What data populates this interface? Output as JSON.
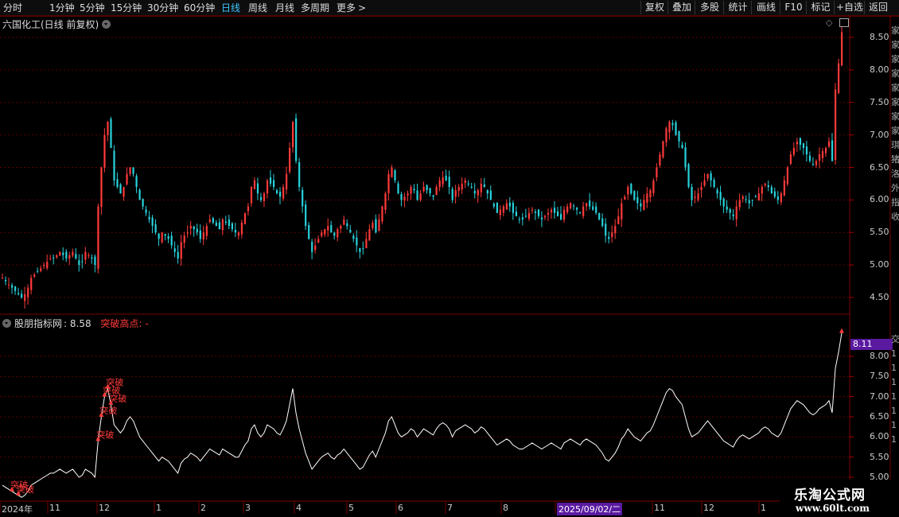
{
  "toolbar": {
    "periods": [
      "分时",
      "1分钟",
      "5分钟",
      "15分钟",
      "30分钟",
      "60分钟",
      "日线",
      "周线",
      "月线",
      "多周期",
      "更多"
    ],
    "active_period": "日线",
    "buttons": [
      "复权",
      "叠加",
      "多股",
      "统计",
      "画线",
      "F10",
      "标记",
      "+自选",
      "返回"
    ],
    "more_arrow": ">"
  },
  "main_pane": {
    "title": "六国化工(日线 前复权)",
    "y_ticks": [
      "8.50",
      "8.00",
      "7.50",
      "7.00",
      "6.50",
      "6.00",
      "5.50",
      "5.00",
      "4.50"
    ]
  },
  "indicator_pane": {
    "name": "股朋指标网",
    "value": ": 8.58",
    "signal_label": "突破高点:",
    "signal_value": "-",
    "y_ticks": [
      "8.00",
      "7.50",
      "7.00",
      "6.50",
      "6.00",
      "5.50",
      "5.00"
    ],
    "current_badge": "8.11",
    "marker_text": "突破"
  },
  "x_axis": {
    "labels": [
      "2024年",
      "11",
      "12",
      "1",
      "2",
      "3",
      "4",
      "5",
      "6",
      "7",
      "8",
      "2025/09/02/二",
      "11",
      "12",
      "1"
    ]
  },
  "right_strip": {
    "top": [
      "家",
      "家",
      "家",
      "家",
      "家",
      "家",
      "家",
      "家",
      "琪",
      "猪",
      "洛",
      "外",
      "指",
      "收"
    ],
    "bottom": [
      "交",
      "1",
      "1",
      "1",
      "1",
      "1",
      "1",
      "1"
    ]
  },
  "watermark": {
    "line1": "乐淘公式网",
    "line2": "www.60lt.com"
  },
  "colors": {
    "up": "#ff3a3a",
    "down": "#28d2dc",
    "grid": "#5a0000",
    "line": "#ffffff",
    "active": "#3fc6ff",
    "badge_bg": "#5a1aa0",
    "date_bg": "#5a1aa0"
  },
  "chart_data": {
    "type": "candlestick",
    "title": "六国化工(日线 前复权)",
    "ylim": [
      4.3,
      8.7
    ],
    "price_line_breakouts": [
      5.25,
      5.05,
      5.05,
      5.75,
      6.3,
      6.85,
      7.7,
      8.5
    ],
    "closes": [
      4.8,
      4.75,
      4.7,
      4.65,
      4.6,
      4.55,
      4.5,
      4.55,
      4.65,
      4.8,
      4.85,
      4.9,
      4.95,
      5.0,
      5.05,
      5.1,
      5.1,
      5.15,
      5.2,
      5.15,
      5.1,
      5.15,
      5.2,
      5.1,
      5.0,
      5.05,
      5.2,
      5.15,
      5.1,
      5.0,
      5.9,
      6.5,
      7.0,
      7.2,
      6.8,
      6.3,
      6.2,
      6.1,
      6.2,
      6.4,
      6.5,
      6.4,
      6.2,
      6.0,
      5.9,
      5.8,
      5.7,
      5.6,
      5.5,
      5.4,
      5.5,
      5.45,
      5.4,
      5.3,
      5.2,
      5.1,
      5.35,
      5.45,
      5.5,
      5.6,
      5.55,
      5.5,
      5.4,
      5.5,
      5.6,
      5.7,
      5.65,
      5.6,
      5.55,
      5.7,
      5.65,
      5.6,
      5.55,
      5.5,
      5.5,
      5.65,
      5.8,
      5.9,
      6.2,
      6.3,
      6.1,
      6.0,
      6.1,
      6.3,
      6.25,
      6.2,
      6.1,
      6.05,
      6.2,
      6.4,
      6.8,
      7.2,
      6.6,
      6.2,
      5.9,
      5.6,
      5.4,
      5.2,
      5.3,
      5.4,
      5.5,
      5.55,
      5.6,
      5.5,
      5.45,
      5.55,
      5.6,
      5.7,
      5.6,
      5.5,
      5.4,
      5.3,
      5.2,
      5.25,
      5.4,
      5.55,
      5.65,
      5.5,
      5.7,
      5.9,
      6.1,
      6.4,
      6.5,
      6.3,
      6.1,
      6.0,
      6.05,
      6.1,
      6.2,
      6.15,
      6.0,
      6.1,
      6.2,
      6.15,
      6.1,
      6.05,
      6.2,
      6.3,
      6.35,
      6.3,
      6.2,
      6.0,
      6.15,
      6.2,
      6.25,
      6.3,
      6.25,
      6.2,
      6.1,
      6.15,
      6.25,
      6.2,
      6.1,
      6.0,
      5.9,
      5.8,
      5.85,
      5.9,
      5.95,
      5.9,
      5.8,
      5.75,
      5.7,
      5.7,
      5.75,
      5.8,
      5.85,
      5.8,
      5.75,
      5.7,
      5.75,
      5.8,
      5.85,
      5.8,
      5.75,
      5.7,
      5.85,
      5.9,
      5.95,
      5.9,
      5.85,
      5.8,
      5.9,
      5.95,
      5.9,
      5.85,
      5.8,
      5.7,
      5.6,
      5.45,
      5.4,
      5.5,
      5.6,
      5.75,
      5.95,
      6.05,
      6.2,
      6.1,
      6.0,
      5.95,
      5.9,
      6.0,
      6.1,
      6.15,
      6.3,
      6.5,
      6.7,
      6.9,
      7.1,
      7.2,
      7.15,
      7.0,
      6.9,
      6.8,
      6.5,
      6.2,
      6.0,
      6.05,
      6.1,
      6.2,
      6.3,
      6.4,
      6.3,
      6.2,
      6.1,
      6.0,
      5.9,
      5.85,
      5.8,
      5.75,
      5.9,
      6.0,
      6.05,
      6.0,
      5.95,
      6.0,
      6.05,
      6.1,
      6.2,
      6.25,
      6.2,
      6.1,
      6.05,
      6.0,
      6.1,
      6.3,
      6.5,
      6.7,
      6.8,
      6.9,
      6.85,
      6.8,
      6.7,
      6.6,
      6.55,
      6.6,
      6.7,
      6.75,
      6.8,
      6.9,
      6.6,
      7.7,
      8.1,
      8.58
    ]
  }
}
